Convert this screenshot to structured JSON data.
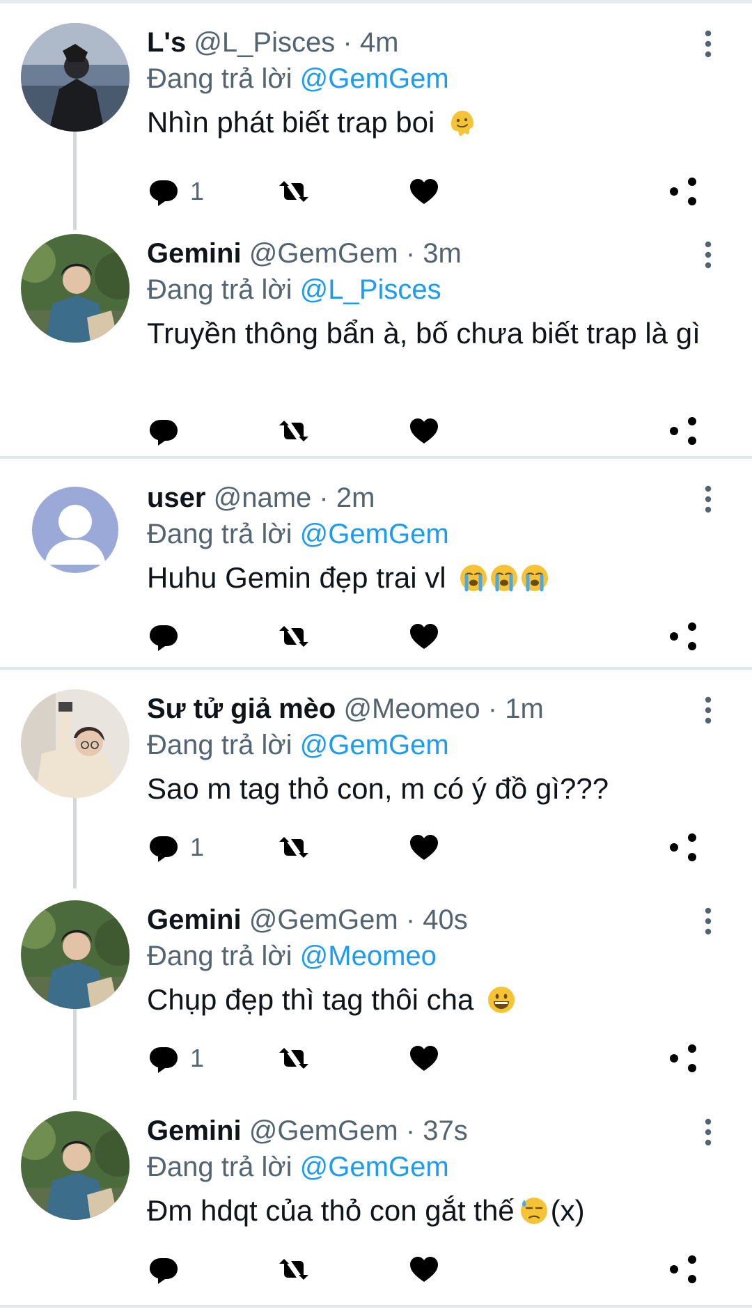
{
  "tweets": [
    {
      "name": "L's",
      "handle": "@L_Pisces",
      "time": "4m",
      "reply_prefix": "Đang trả lời",
      "reply_to": "@GemGem",
      "text": "Nhìn phát biết trap boi",
      "emoji": "melting-face",
      "reply_count": "1"
    },
    {
      "name": "Gemini",
      "handle": "@GemGem",
      "time": "3m",
      "reply_prefix": "Đang trả lời",
      "reply_to": "@L_Pisces",
      "text": "Truyền thông bẩn à, bố chưa biết trap là gì",
      "reply_count": ""
    },
    {
      "name": "user",
      "handle": "@name",
      "time": "2m",
      "reply_prefix": "Đang trả lời",
      "reply_to": "@GemGem",
      "text": "Huhu Gemin đẹp trai vl",
      "emoji": "loudly-crying-face x3",
      "reply_count": ""
    },
    {
      "name": "Sư tử giả mèo",
      "handle": "@Meomeo",
      "time": "1m",
      "reply_prefix": "Đang trả lời",
      "reply_to": "@GemGem",
      "text": "Sao m tag thỏ con, m có ý đồ gì???",
      "reply_count": "1"
    },
    {
      "name": "Gemini",
      "handle": "@GemGem",
      "time": "40s",
      "reply_prefix": "Đang trả lời",
      "reply_to": "@Meomeo",
      "text": "Chụp đẹp thì tag thôi cha",
      "emoji": "grinning-face",
      "reply_count": "1"
    },
    {
      "name": "Gemini",
      "handle": "@GemGem",
      "time": "37s",
      "reply_prefix": "Đang trả lời",
      "reply_to": "@GemGem",
      "text": "Đm hdqt của thỏ con gắt thế",
      "emoji": "downcast-face-with-sweat",
      "text_suffix": "(x)",
      "reply_count": ""
    }
  ],
  "separator": "·",
  "icons": [
    "reply-icon",
    "retweet-icon",
    "like-icon",
    "stats-icon",
    "share-icon",
    "more-icon"
  ],
  "colors": {
    "text": "#0f1419",
    "muted": "#536471",
    "link": "#1d9bf0",
    "divider": "#e1e8ed"
  }
}
